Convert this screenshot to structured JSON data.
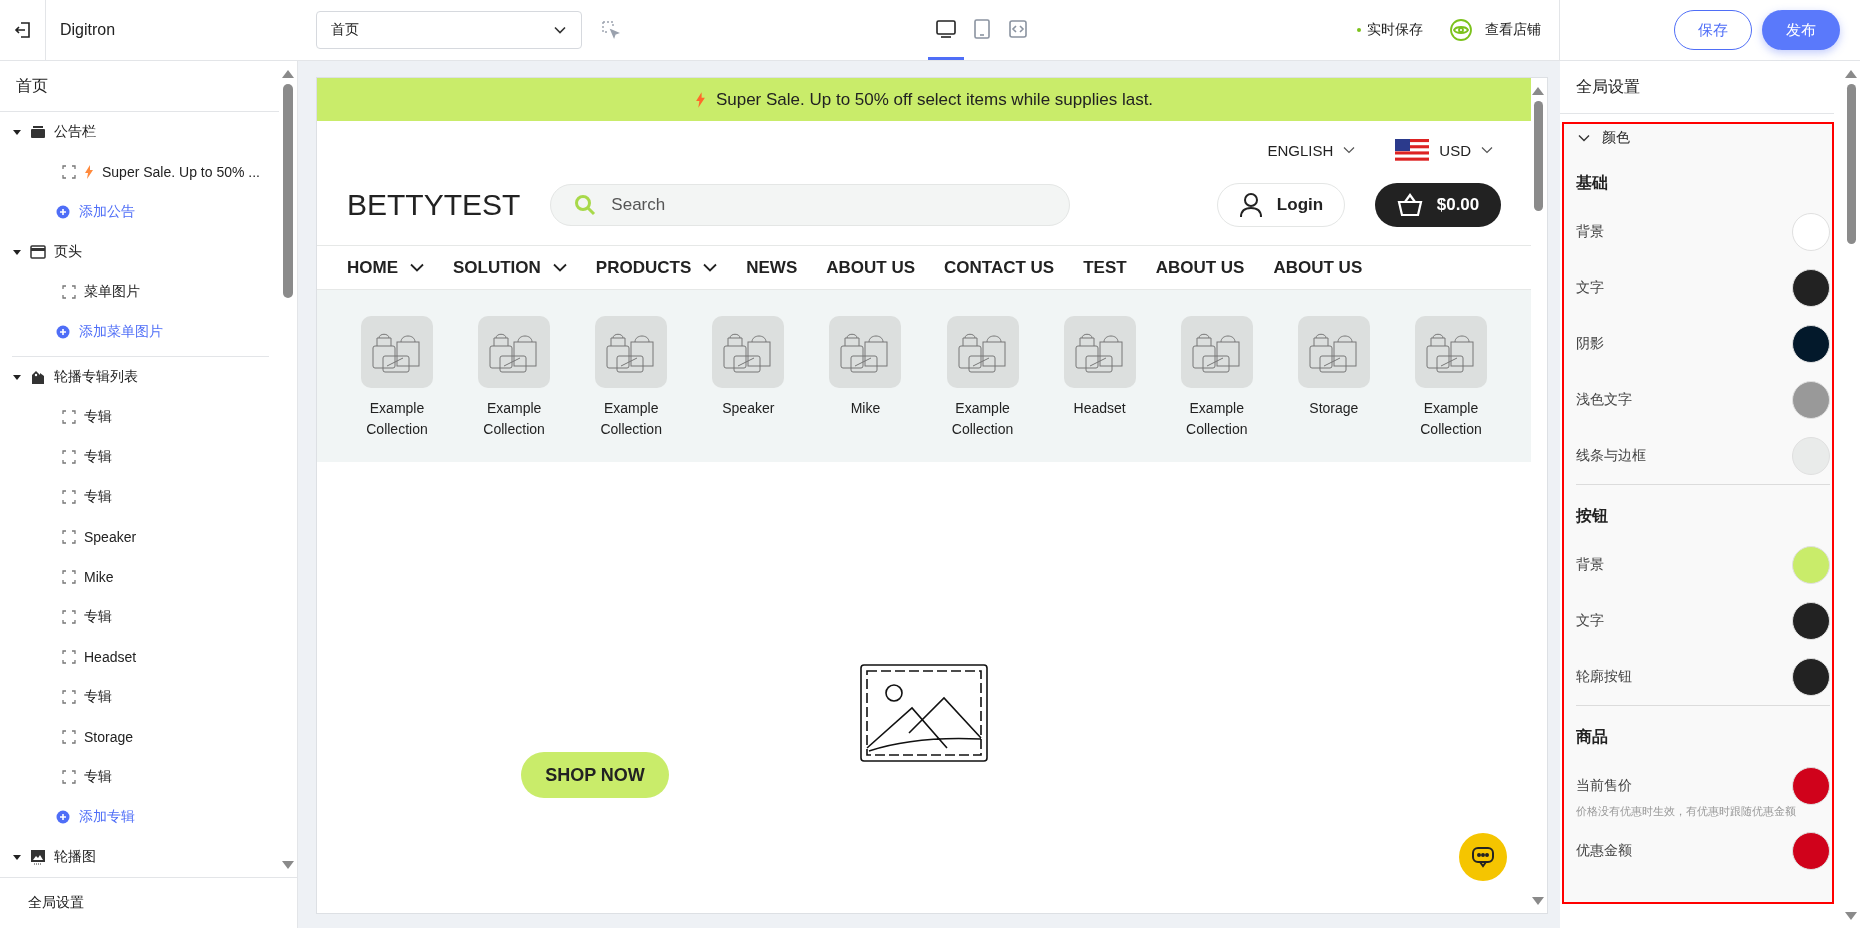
{
  "topbar": {
    "app_name": "Digitron",
    "page_select": {
      "value": "首页"
    },
    "devices": [
      {
        "selected": true
      },
      {
        "selected": false
      },
      {
        "selected": false
      }
    ],
    "autosave": "实时保存",
    "view_store": "查看店铺",
    "save": "保存",
    "publish": "发布"
  },
  "sidebar": {
    "title": "首页",
    "sections": [
      {
        "label": "公告栏",
        "expanded": true,
        "children": [
          {
            "kind": "item",
            "label": "Super Sale. Up to 50% ...",
            "bolt": true
          },
          {
            "kind": "add",
            "label": "添加公告"
          }
        ]
      },
      {
        "label": "页头",
        "expanded": true,
        "children": [
          {
            "kind": "item",
            "label": "菜单图片",
            "bolt": false
          },
          {
            "kind": "add",
            "label": "添加菜单图片"
          }
        ]
      },
      {
        "label": "轮播专辑列表",
        "expanded": true,
        "children": [
          {
            "kind": "item",
            "label": "专辑",
            "bolt": false
          },
          {
            "kind": "item",
            "label": "专辑",
            "bolt": false
          },
          {
            "kind": "item",
            "label": "专辑",
            "bolt": false
          },
          {
            "kind": "item",
            "label": "Speaker",
            "bolt": false
          },
          {
            "kind": "item",
            "label": "Mike",
            "bolt": false
          },
          {
            "kind": "item",
            "label": "专辑",
            "bolt": false
          },
          {
            "kind": "item",
            "label": "Headset",
            "bolt": false
          },
          {
            "kind": "item",
            "label": "专辑",
            "bolt": false
          },
          {
            "kind": "item",
            "label": "Storage",
            "bolt": false
          },
          {
            "kind": "item",
            "label": "专辑",
            "bolt": false
          },
          {
            "kind": "add",
            "label": "添加专辑"
          }
        ]
      },
      {
        "label": "轮播图",
        "expanded": true
      }
    ],
    "footer": "全局设置"
  },
  "preview": {
    "announcement": "Super Sale. Up to 50% off select items while supplies last.",
    "language": "ENGLISH",
    "currency": "USD",
    "logo": "BETTYTEST",
    "search": {
      "placeholder": "Search"
    },
    "login": "Login",
    "cart": "$0.00",
    "nav": [
      {
        "label": "HOME",
        "dropdown": true
      },
      {
        "label": "SOLUTION",
        "dropdown": true
      },
      {
        "label": "PRODUCTS",
        "dropdown": true
      },
      {
        "label": "NEWS",
        "dropdown": false
      },
      {
        "label": "ABOUT US",
        "dropdown": false
      },
      {
        "label": "CONTACT US",
        "dropdown": false
      },
      {
        "label": "TEST",
        "dropdown": false
      },
      {
        "label": "ABOUT US",
        "dropdown": false
      },
      {
        "label": "ABOUT US",
        "dropdown": false
      }
    ],
    "collections": [
      "Example Collection",
      "Example Collection",
      "Example Collection",
      "Speaker",
      "Mike",
      "Example Collection",
      "Headset",
      "Example Collection",
      "Storage",
      "Example Collection"
    ],
    "hero_button": "SHOP NOW"
  },
  "settings": {
    "title": "全局设置",
    "section": {
      "label": "颜色",
      "expanded": true
    },
    "groups": [
      {
        "title": "基础",
        "items": [
          {
            "label": "背景",
            "color": "#ffffff"
          },
          {
            "label": "文字",
            "color": "#222222"
          },
          {
            "label": "阴影",
            "color": "#03192b"
          },
          {
            "label": "浅色文字",
            "color": "#999999"
          },
          {
            "label": "线条与边框",
            "color": "#e9ebea"
          }
        ]
      },
      {
        "title": "按钮",
        "items": [
          {
            "label": "背景",
            "color": "#c9ec6a"
          },
          {
            "label": "文字",
            "color": "#222222"
          },
          {
            "label": "轮廓按钮",
            "color": "#222222"
          }
        ]
      },
      {
        "title": "商品",
        "items": [
          {
            "label": "当前售价",
            "color": "#d0021b",
            "note": "价格没有优惠时生效，有优惠时跟随优惠金额"
          },
          {
            "label": "优惠金额",
            "color": "#d0021b"
          }
        ]
      }
    ]
  }
}
